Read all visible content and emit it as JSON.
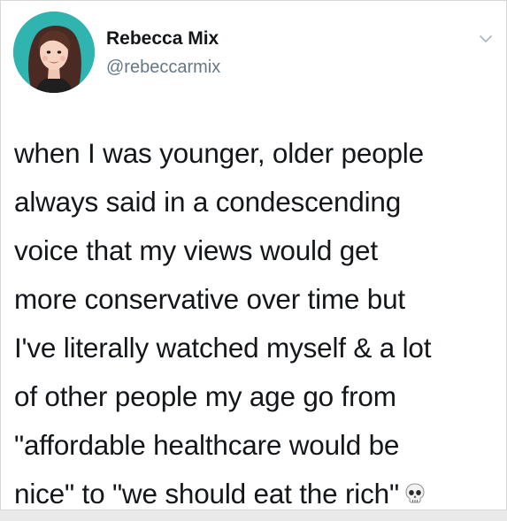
{
  "tweet": {
    "author": {
      "display_name": "Rebecca Mix",
      "handle": "@rebeccarmix",
      "avatar_icon": "cartoon-woman-portrait",
      "avatar_bg": "#2fb4b0"
    },
    "menu_icon": "chevron-down-icon",
    "text_lines": [
      "when I was younger, older people",
      "always said in a condescending",
      "voice that my views would get",
      "more conservative over time but",
      "I've literally watched myself & a lot",
      "of other people my age go from",
      "\"affordable healthcare would be",
      "nice\" to \"we should eat the rich\""
    ],
    "trailing_emoji": "skull-icon"
  }
}
